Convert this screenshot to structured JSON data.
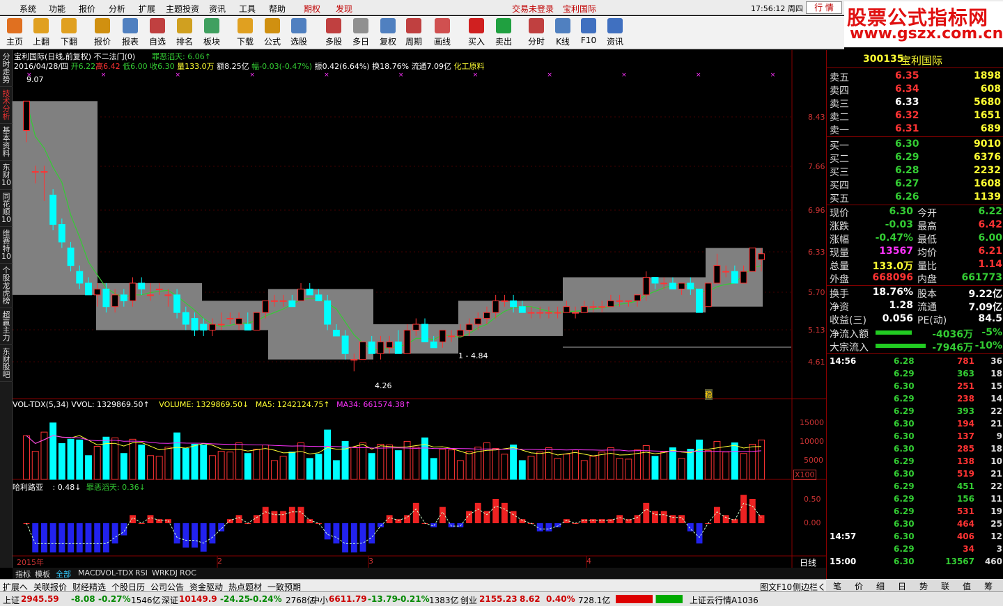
{
  "menu": {
    "items": [
      "系统",
      "功能",
      "报价",
      "分析",
      "扩展",
      "主题投资",
      "资讯",
      "工具",
      "帮助"
    ],
    "qiquan": "期权",
    "faxian": "发现",
    "trade_login": "交易未登录",
    "stock_name": "宝利国际",
    "clock": "17:56:12 周四",
    "hangqing": "行 情"
  },
  "logo": {
    "line1": "股票公式指标网",
    "line2": "www.gszx.com.cn"
  },
  "toolbar": {
    "items": [
      {
        "label": "主页",
        "icon": "home-icon",
        "color": "#e07020"
      },
      {
        "label": "上翻",
        "icon": "up-arrow-icon",
        "color": "#e0a020"
      },
      {
        "label": "下翻",
        "icon": "down-arrow-icon",
        "color": "#e0a020"
      },
      {
        "label": "报价",
        "icon": "quote-icon",
        "color": "#d09010"
      },
      {
        "label": "报表",
        "icon": "report-icon",
        "color": "#5080c0"
      },
      {
        "label": "自选",
        "icon": "f6-icon",
        "color": "#c04040"
      },
      {
        "label": "排名",
        "icon": "rank-icon",
        "color": "#d0a020"
      },
      {
        "label": "板块",
        "icon": "sector-icon",
        "color": "#40a060"
      },
      {
        "label": "下载",
        "icon": "download-icon",
        "color": "#e0a020"
      },
      {
        "label": "公式",
        "icon": "formula-icon",
        "color": "#d09010"
      },
      {
        "label": "选股",
        "icon": "pick-stock-icon",
        "color": "#5080c0"
      },
      {
        "label": "多股",
        "icon": "multi-stock-icon",
        "color": "#c04040"
      },
      {
        "label": "多日",
        "icon": "multi-day-icon",
        "color": "#909090"
      },
      {
        "label": "复权",
        "icon": "restore-icon",
        "color": "#5080c0"
      },
      {
        "label": "周期",
        "icon": "f8-icon",
        "color": "#c04040"
      },
      {
        "label": "画线",
        "icon": "draw-line-icon",
        "color": "#d05050"
      },
      {
        "label": "买入",
        "icon": "buy-icon",
        "color": "#d02020"
      },
      {
        "label": "卖出",
        "icon": "sell-icon",
        "color": "#20a040"
      },
      {
        "label": "分时",
        "icon": "intraday-icon",
        "color": "#c04040"
      },
      {
        "label": "K线",
        "icon": "kline-icon",
        "color": "#5080c0"
      },
      {
        "label": "F10",
        "icon": "f10-icon",
        "color": "#4070c0"
      },
      {
        "label": "资讯",
        "icon": "news-icon",
        "color": "#4070c0"
      }
    ]
  },
  "leftnav": [
    "分时走势",
    "技术分析",
    "基本资料",
    "东财10",
    "同花顺10",
    "维赛特10",
    "个股龙虎榜",
    "超赢主力",
    "东财股吧"
  ],
  "main": {
    "header": {
      "title": "宝利国际(日线,前复权) 不二法门(0)",
      "sig_label": "罪恶滔天: 6.06↑"
    },
    "info": {
      "date": "2016/04/28/四",
      "open": "开6.22",
      "high": "高6.42",
      "low": "低6.00",
      "close": "收6.30",
      "vol": "量133.0万",
      "amt": "额8.25亿",
      "chg": "幅-0.03(-0.47%)",
      "amp": "振0.42(6.64%)",
      "turn": "换18.76%",
      "float": "流通7.09亿",
      "sector": "化工原料"
    },
    "yaxis": [
      "8.43",
      "7.66",
      "6.96",
      "6.33",
      "5.70",
      "5.13",
      "4.61"
    ],
    "annots": {
      "max": "9.07",
      "min": "4.26",
      "range": "1 - 4.84"
    },
    "vol_header": {
      "name": "VOL-TDX(5,34)",
      "vvol": "VVOL: 1329869.50↑",
      "volume": "VOLUME: 1329869.50↓",
      "ma5": "MA5: 1242124.75↑",
      "ma34": "MA34: 661574.38↑"
    },
    "vol_yaxis": [
      "15000",
      "10000",
      "5000"
    ],
    "vol_unit": "X100",
    "ind_header": {
      "name": "哈利路亚",
      "v1": ": 0.48↓",
      "v2": "罪恶滔天: 0.36↓"
    },
    "ind_yaxis": [
      "0.50",
      "0.00"
    ],
    "xaxis": {
      "year": "2015年",
      "m2": "2",
      "m3": "3",
      "m4": "4",
      "period": "日线"
    },
    "scroll": {
      "plus": "+",
      "minus": "-",
      "zero": "0"
    },
    "wen": "稳"
  },
  "chart_data": {
    "type": "candlestick",
    "note": "日K线",
    "ohlc": [
      [
        8.4,
        8.9,
        8.2,
        8.9
      ],
      [
        7.7,
        7.8,
        7.5,
        7.7
      ],
      [
        7.7,
        7.8,
        7.2,
        7.7
      ],
      [
        7.3,
        7.4,
        6.7,
        6.8
      ],
      [
        6.8,
        6.9,
        6.4,
        6.5
      ],
      [
        6.4,
        6.5,
        6.0,
        6.1
      ],
      [
        6.0,
        6.1,
        5.7,
        5.8
      ],
      [
        5.8,
        5.9,
        5.6,
        5.6
      ],
      [
        5.6,
        5.8,
        5.4,
        5.7
      ],
      [
        5.7,
        5.8,
        5.3,
        5.4
      ],
      [
        5.4,
        5.7,
        5.3,
        5.6
      ],
      [
        5.6,
        5.7,
        5.4,
        5.5
      ],
      [
        5.5,
        5.9,
        5.4,
        5.8
      ],
      [
        5.8,
        5.9,
        5.6,
        5.7
      ],
      [
        5.6,
        5.8,
        5.5,
        5.6
      ],
      [
        5.7,
        5.8,
        5.6,
        5.7
      ],
      [
        5.6,
        5.7,
        5.4,
        5.6
      ],
      [
        5.6,
        5.7,
        5.2,
        5.3
      ],
      [
        5.3,
        5.4,
        5.0,
        5.1
      ],
      [
        5.2,
        5.3,
        4.9,
        5.0
      ],
      [
        5.1,
        5.2,
        4.9,
        5.0
      ],
      [
        5.0,
        5.2,
        4.9,
        5.1
      ],
      [
        5.1,
        5.3,
        5.0,
        5.1
      ],
      [
        5.2,
        5.3,
        5.1,
        5.2
      ],
      [
        5.1,
        5.3,
        5.0,
        5.2
      ],
      [
        5.1,
        5.3,
        5.0,
        5.0
      ],
      [
        5.0,
        5.3,
        5.0,
        5.3
      ],
      [
        5.3,
        5.5,
        5.2,
        5.5
      ],
      [
        5.5,
        5.6,
        5.4,
        5.5
      ],
      [
        5.5,
        5.6,
        5.4,
        5.5
      ],
      [
        5.5,
        5.6,
        5.4,
        5.4
      ],
      [
        5.5,
        5.8,
        5.5,
        5.7
      ],
      [
        5.7,
        5.8,
        5.6,
        5.6
      ],
      [
        5.6,
        5.7,
        5.5,
        5.5
      ],
      [
        5.5,
        5.6,
        5.0,
        5.1
      ],
      [
        5.0,
        5.1,
        4.9,
        4.9
      ],
      [
        4.9,
        5.0,
        4.5,
        4.6
      ],
      [
        4.5,
        4.6,
        4.3,
        4.5
      ],
      [
        4.5,
        4.8,
        4.5,
        4.8
      ],
      [
        4.8,
        4.9,
        4.6,
        4.6
      ],
      [
        4.6,
        4.9,
        4.5,
        4.8
      ],
      [
        4.7,
        4.9,
        4.6,
        4.8
      ],
      [
        4.8,
        5.0,
        4.6,
        4.6
      ],
      [
        4.6,
        5.1,
        4.6,
        5.0
      ],
      [
        5.0,
        5.2,
        4.9,
        5.1
      ],
      [
        5.1,
        5.2,
        4.8,
        4.8
      ],
      [
        4.8,
        4.9,
        4.7,
        4.7
      ],
      [
        4.8,
        5.0,
        4.7,
        5.0
      ],
      [
        4.9,
        5.0,
        4.8,
        4.9
      ],
      [
        4.9,
        5.1,
        4.9,
        5.0
      ],
      [
        5.0,
        5.2,
        4.9,
        5.1
      ],
      [
        5.1,
        5.3,
        5.0,
        5.2
      ],
      [
        5.2,
        5.4,
        5.1,
        5.3
      ],
      [
        5.3,
        5.6,
        5.2,
        5.5
      ],
      [
        5.5,
        5.6,
        5.4,
        5.5
      ],
      [
        5.5,
        5.6,
        5.3,
        5.4
      ],
      [
        5.4,
        5.5,
        5.3,
        5.3
      ],
      [
        5.3,
        5.4,
        5.2,
        5.3
      ],
      [
        5.3,
        5.4,
        5.2,
        5.3
      ],
      [
        5.3,
        5.4,
        5.2,
        5.3
      ],
      [
        5.3,
        5.4,
        5.2,
        5.3
      ],
      [
        5.3,
        5.5,
        5.3,
        5.4
      ],
      [
        5.3,
        5.4,
        5.2,
        5.3
      ],
      [
        5.3,
        5.5,
        5.3,
        5.4
      ],
      [
        5.4,
        5.5,
        5.3,
        5.4
      ],
      [
        5.4,
        5.5,
        5.3,
        5.4
      ],
      [
        5.4,
        5.6,
        5.4,
        5.5
      ],
      [
        5.5,
        5.6,
        5.4,
        5.5
      ],
      [
        5.5,
        5.5,
        5.4,
        5.5
      ],
      [
        5.5,
        5.6,
        5.4,
        5.6
      ],
      [
        5.6,
        6.0,
        5.5,
        5.9
      ],
      [
        5.9,
        5.9,
        5.7,
        5.8
      ],
      [
        5.8,
        5.9,
        5.7,
        5.8
      ],
      [
        5.8,
        5.9,
        5.7,
        5.7
      ],
      [
        5.7,
        5.8,
        5.6,
        5.8
      ],
      [
        5.8,
        5.9,
        5.6,
        5.7
      ],
      [
        5.7,
        5.7,
        5.3,
        5.3
      ],
      [
        5.4,
        5.8,
        5.4,
        5.8
      ],
      [
        5.8,
        6.3,
        5.8,
        6.1
      ],
      [
        6.0,
        6.1,
        5.9,
        6.0
      ],
      [
        6.0,
        6.1,
        5.8,
        5.8
      ],
      [
        5.8,
        6.1,
        5.8,
        6.0
      ],
      [
        6.0,
        6.4,
        6.0,
        6.4
      ],
      [
        6.2,
        6.4,
        6.0,
        6.3
      ]
    ]
  },
  "right": {
    "code": "300135",
    "name": "宝利国际",
    "sells": [
      {
        "l": "卖五",
        "p": "6.35",
        "v": "1898"
      },
      {
        "l": "卖四",
        "p": "6.34",
        "v": "608"
      },
      {
        "l": "卖三",
        "p": "6.33",
        "v": "5680"
      },
      {
        "l": "卖二",
        "p": "6.32",
        "v": "1651"
      },
      {
        "l": "卖一",
        "p": "6.31",
        "v": "689"
      }
    ],
    "buys": [
      {
        "l": "买一",
        "p": "6.30",
        "v": "9010"
      },
      {
        "l": "买二",
        "p": "6.29",
        "v": "6376"
      },
      {
        "l": "买三",
        "p": "6.28",
        "v": "2232"
      },
      {
        "l": "买四",
        "p": "6.27",
        "v": "1608"
      },
      {
        "l": "买五",
        "p": "6.26",
        "v": "1139"
      }
    ],
    "stats": [
      {
        "a": "现价",
        "av": "6.30",
        "b": "今开",
        "bv": "6.22"
      },
      {
        "a": "涨跌",
        "av": "-0.03",
        "b": "最高",
        "bv": "6.42"
      },
      {
        "a": "涨幅",
        "av": "-0.47%",
        "b": "最低",
        "bv": "6.00"
      },
      {
        "a": "现量",
        "av": "13567",
        "b": "均价",
        "bv": "6.21"
      },
      {
        "a": "总量",
        "av": "133.0万",
        "b": "量比",
        "bv": "1.14"
      },
      {
        "a": "外盘",
        "av": "668096",
        "b": "内盘",
        "bv": "661773"
      }
    ],
    "stats2": [
      {
        "a": "换手",
        "av": "18.76%",
        "b": "股本",
        "bv": "9.22亿"
      },
      {
        "a": "净资",
        "av": "1.28",
        "b": "流通",
        "bv": "7.09亿"
      },
      {
        "a": "收益(三)",
        "av": "0.056",
        "b": "PE(动)",
        "bv": "84.5"
      }
    ],
    "flows": [
      {
        "l": "净流入额",
        "v": "-4036万",
        "p": "-5%"
      },
      {
        "l": "大宗流入",
        "v": "-7946万",
        "p": "-10%"
      }
    ],
    "ticks": [
      {
        "t": "14:56",
        "p": "6.28",
        "v": "781",
        "n": "36"
      },
      {
        "t": "",
        "p": "6.29",
        "v": "363",
        "n": "18"
      },
      {
        "t": "",
        "p": "6.30",
        "v": "251",
        "n": "15"
      },
      {
        "t": "",
        "p": "6.29",
        "v": "238",
        "n": "14"
      },
      {
        "t": "",
        "p": "6.29",
        "v": "393",
        "n": "22"
      },
      {
        "t": "",
        "p": "6.30",
        "v": "194",
        "n": "21"
      },
      {
        "t": "",
        "p": "6.30",
        "v": "137",
        "n": "9"
      },
      {
        "t": "",
        "p": "6.30",
        "v": "285",
        "n": "18"
      },
      {
        "t": "",
        "p": "6.29",
        "v": "138",
        "n": "10"
      },
      {
        "t": "",
        "p": "6.30",
        "v": "519",
        "n": "21"
      },
      {
        "t": "",
        "p": "6.29",
        "v": "451",
        "n": "22"
      },
      {
        "t": "",
        "p": "6.29",
        "v": "156",
        "n": "11"
      },
      {
        "t": "",
        "p": "6.29",
        "v": "531",
        "n": "19"
      },
      {
        "t": "",
        "p": "6.30",
        "v": "464",
        "n": "25"
      },
      {
        "t": "14:57",
        "p": "6.30",
        "v": "406",
        "n": "12"
      },
      {
        "t": "",
        "p": "6.29",
        "v": "34",
        "n": "3"
      },
      {
        "t": "15:00",
        "p": "6.30",
        "v": "13567",
        "n": "460"
      }
    ],
    "tabs": [
      "笔",
      "价",
      "细",
      "日",
      "势",
      "联",
      "值",
      "筹"
    ]
  },
  "bottom": {
    "tabs": [
      "指标",
      "模板",
      "全部",
      "MACD",
      "VOL-TDX",
      "RSI",
      "WR",
      "KDJ",
      "ROC"
    ],
    "links": [
      "扩展へ",
      "关联报价",
      "财经精选",
      "个股日历",
      "公司公告",
      "资金驱动",
      "热点题材",
      "一致预期"
    ],
    "right_links": [
      "图文F10",
      "侧边栏く"
    ]
  },
  "status": {
    "sh_name": "上证",
    "sh_val": "2945.59",
    "sh_chg": "-8.08",
    "sh_pct": "-0.27%",
    "sh_amt": "1546亿",
    "sz_name": "深证",
    "sz_val": "10149.9",
    "sz_chg": "-24.25",
    "sz_pct": "-0.24%",
    "sz_amt": "2768亿",
    "zx_name": "中小",
    "zx_val": "6611.79",
    "zx_chg": "-13.79",
    "zx_pct": "-0.21%",
    "zx_amt": "1383亿",
    "cy_name": "创业",
    "cy_val": "2155.23",
    "cy_chg": "8.62",
    "cy_pct": "0.40%",
    "cy_amt": "728.1亿",
    "server": "上证云行情A1036"
  }
}
